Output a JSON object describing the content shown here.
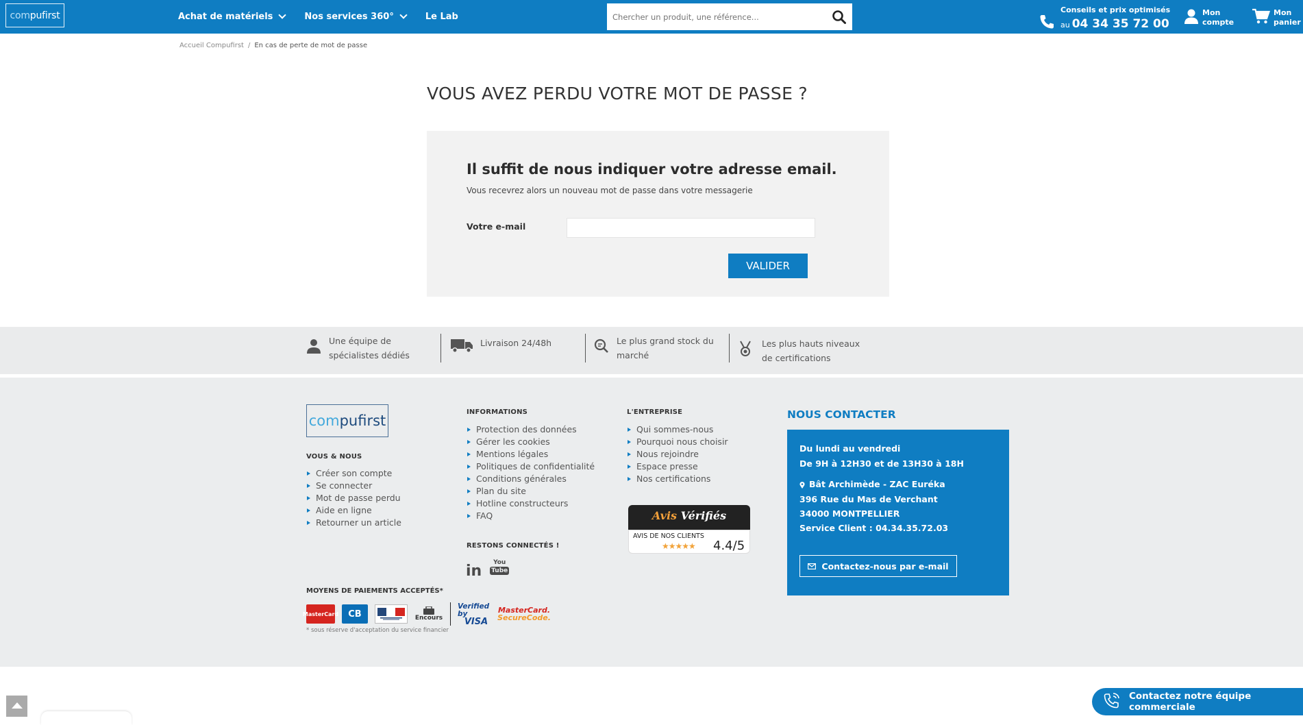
{
  "colors": {
    "brand_blue": "#0f7dc2",
    "footer_bg": "#ebedee",
    "band_bg": "#eaebec",
    "panel_bg": "#f2f2f2"
  },
  "header": {
    "logo": {
      "part1": "com",
      "part2": "pufirst"
    },
    "nav": [
      {
        "label": "Achat de matériels",
        "has_dropdown": true
      },
      {
        "label": "Nos services 360°",
        "has_dropdown": true
      },
      {
        "label": "Le Lab",
        "has_dropdown": false
      }
    ],
    "search": {
      "placeholder": "Chercher un produit, une référence...",
      "icon": "search-icon"
    },
    "phone": {
      "line1": "Conseils et prix optimisés",
      "prefix": "au",
      "number": "04 34 35 72 00",
      "icon": "phone-icon"
    },
    "account": {
      "label": "Mon compte",
      "icon": "user-icon"
    },
    "cart": {
      "label": "Mon panier",
      "icon": "cart-icon"
    }
  },
  "breadcrumb": {
    "home": "Accueil Compufirst",
    "separator": "/",
    "current": "En cas de perte de mot de passe"
  },
  "main": {
    "title": "VOUS AVEZ PERDU VOTRE MOT DE PASSE ?",
    "panel_heading": "Il suffit de nous indiquer votre adresse email.",
    "panel_sub": "Vous recevrez alors un nouveau mot de passe dans votre messagerie",
    "email_label": "Votre e-mail",
    "email_value": "",
    "submit_label": "VALIDER"
  },
  "reassurance": [
    {
      "line1": "Une équipe de",
      "line2": "spécialistes dédiés",
      "icon": "user-icon"
    },
    {
      "line1": "Livraison 24/48h",
      "line2": "",
      "icon": "truck-icon"
    },
    {
      "line1": "Le plus grand stock du",
      "line2": "marché",
      "icon": "stock-search-icon"
    },
    {
      "line1": "Les plus hauts niveaux",
      "line2": "de certifications",
      "icon": "medal-icon"
    }
  ],
  "footer": {
    "logo": {
      "part1": "com",
      "part2": "pufirst"
    },
    "vous_title": "VOUS & NOUS",
    "vous_links": [
      "Créer son compte",
      "Se connecter",
      "Mot de passe perdu",
      "Aide en ligne",
      "Retourner un article"
    ],
    "info_title": "INFORMATIONS",
    "info_links": [
      "Protection des données",
      "Gérer les cookies",
      "Mentions légales",
      "Politiques de confidentialité",
      "Conditions générales",
      "Plan du site",
      "Hotline constructeurs",
      "FAQ"
    ],
    "entreprise_title": "L'ENTREPRISE",
    "entreprise_links": [
      "Qui sommes-nous",
      "Pourquoi nous choisir",
      "Nous rejoindre",
      "Espace presse",
      "Nos certifications"
    ],
    "social_title": "RESTONS CONNECTÉS !",
    "social": {
      "linkedin": "in",
      "youtube_top": "You",
      "youtube_bottom": "Tube"
    },
    "avis": {
      "brand_part1": "Avis",
      "brand_part2": "Vérifiés",
      "label": "AVIS DE NOS CLIENTS",
      "stars": "★★★★★",
      "score": "4.4/5",
      "rating": 4.4
    },
    "contact_title": "NOUS CONTACTER",
    "contact": {
      "hours1": "Du lundi au vendredi",
      "hours2": "De 9H à 12H30 et de 13H30 à 18H",
      "address1": "Bât Archimède - ZAC Euréka",
      "address2": "396 Rue du Mas de Verchant",
      "address3": "34000 MONTPELLIER",
      "service": "Service Client : 04.34.35.72.03",
      "button": "Contactez-nous par e-mail"
    },
    "payment_title": "MOYENS DE PAIEMENTS ACCEPTÉS*",
    "payments": {
      "mastercard": "MasterCard",
      "cb": "CB",
      "encours": "Encours",
      "vbv_1": "Verified by",
      "vbv_2": "VISA",
      "msc_1": "MasterCard.",
      "msc_2": "SecureCode."
    },
    "payment_note": "* sous réserve d'acceptation du service financier"
  },
  "floating": {
    "sales_button": "Contactez notre équipe commerciale"
  }
}
